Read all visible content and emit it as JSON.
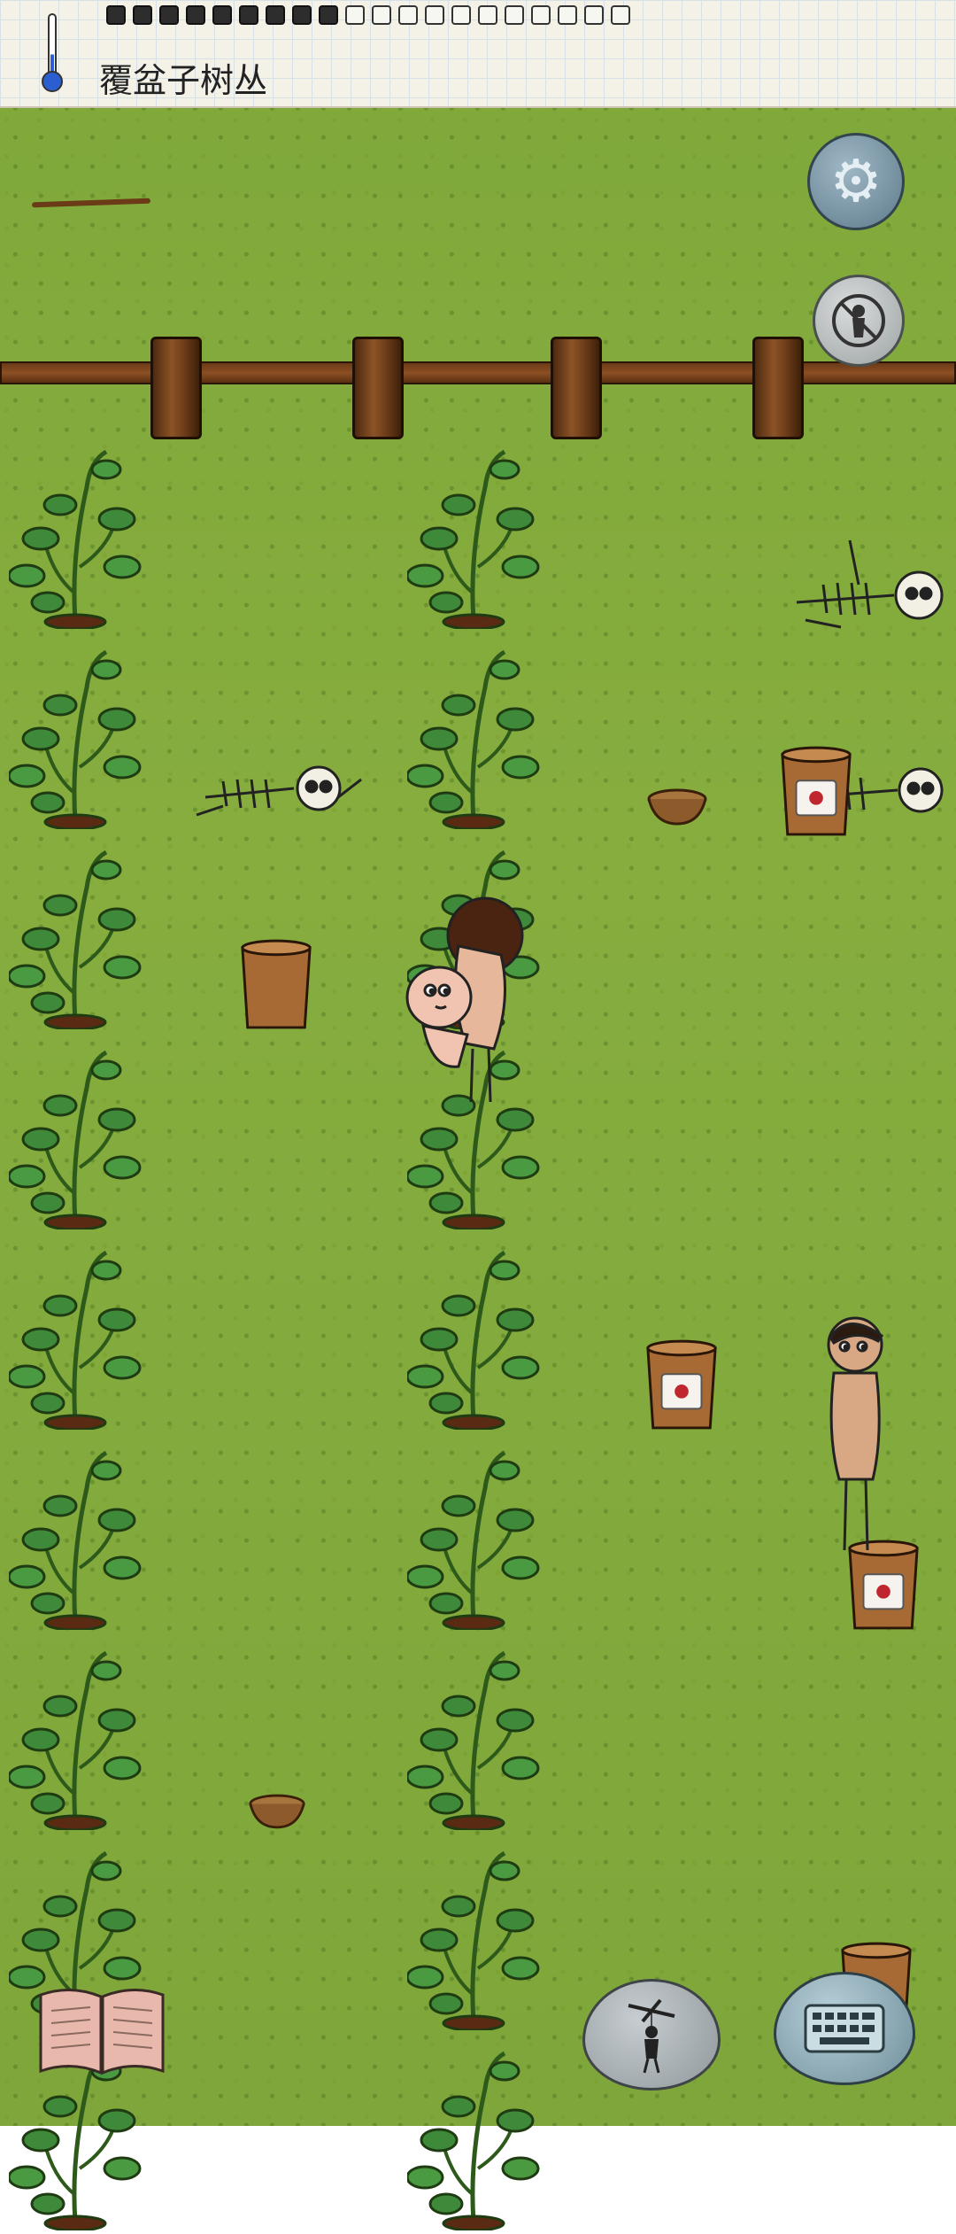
{
  "hud": {
    "hovered_object_label": "覆盆子树丛",
    "food_pips_total": 20,
    "food_pips_filled": 9,
    "temperature_level": 0.35
  },
  "buttons": {
    "settings_icon": "gear-icon",
    "hide_icon": "eye-off-person-icon",
    "emote_icon": "puppet-icon",
    "keyboard_icon": "keyboard-icon",
    "tech_tree_icon": "open-book-icon"
  },
  "colors": {
    "grass": "#86ad3e",
    "fence_wood": "#7a4520",
    "settings_button": "#7c98a8",
    "keyboard_button": "#8fb0bc"
  }
}
